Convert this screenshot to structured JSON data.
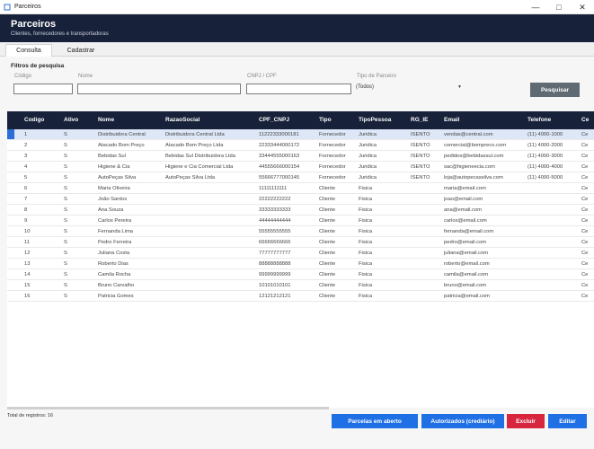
{
  "window": {
    "title": "Parceiros"
  },
  "header": {
    "title": "Parceiros",
    "subtitle": "Clientes, fornecedores e transportadoras"
  },
  "tabs": [
    {
      "label": "Consulta"
    },
    {
      "label": "Cadastrar"
    }
  ],
  "filters": {
    "title": "Filtros de pesquisa",
    "codigo_label": "Código",
    "nome_label": "Nome",
    "cnpj_label": "CNPJ / CPF",
    "tipo_label": "Tipo de Parceiro",
    "tipo_value": "(Todos)",
    "search_button": "Pesquisar"
  },
  "grid": {
    "columns": [
      "Codigo",
      "Ativo",
      "Nome",
      "RazaoSocial",
      "CPF_CNPJ",
      "Tipo",
      "TipoPessoa",
      "RG_IE",
      "Email",
      "Telefone",
      "Ce"
    ],
    "rows": [
      [
        "1",
        "S",
        "Distribuidora Central",
        "Distribuidora Central Ltda",
        "11222333000181",
        "Fornecedor",
        "Juridica",
        "ISENTO",
        "vendas@central.com",
        "(11) 4000-1000",
        "Ce"
      ],
      [
        "2",
        "S",
        "Atacado Bom Preço",
        "Atacado Bom Preço Ltda",
        "22333444000172",
        "Fornecedor",
        "Juridica",
        "ISENTO",
        "comercial@bompreco.com",
        "(11) 4000-2000",
        "Ce"
      ],
      [
        "3",
        "S",
        "Bebidas Sul",
        "Bebidas Sul Distribuidora Ltda",
        "33444555000163",
        "Fornecedor",
        "Juridica",
        "ISENTO",
        "pedidos@bebidassul.com",
        "(11) 4000-3000",
        "Ce"
      ],
      [
        "4",
        "S",
        "Higiene & Cia",
        "Higiene e Cia Comercial Ltda",
        "44555666000154",
        "Fornecedor",
        "Juridica",
        "ISENTO",
        "sac@higieneecia.com",
        "(11) 4000-4000",
        "Ce"
      ],
      [
        "5",
        "S",
        "AutoPeças Silva",
        "AutoPeças Silva Ltda",
        "55666777000145",
        "Fornecedor",
        "Juridica",
        "ISENTO",
        "loja@autopecassilva.com",
        "(11) 4000-5000",
        "Ce"
      ],
      [
        "6",
        "S",
        "Maria Oliveira",
        "",
        "11111111111",
        "Cliente",
        "Fisica",
        "",
        "maria@email.com",
        "",
        "Ce"
      ],
      [
        "7",
        "S",
        "João Santos",
        "",
        "22222222222",
        "Cliente",
        "Fisica",
        "",
        "joao@email.com",
        "",
        "Ce"
      ],
      [
        "8",
        "S",
        "Ana Souza",
        "",
        "33333333333",
        "Cliente",
        "Fisica",
        "",
        "ana@email.com",
        "",
        "Ce"
      ],
      [
        "9",
        "S",
        "Carlos Pereira",
        "",
        "44444444444",
        "Cliente",
        "Fisica",
        "",
        "carlos@email.com",
        "",
        "Ce"
      ],
      [
        "10",
        "S",
        "Fernanda Lima",
        "",
        "55555555555",
        "Cliente",
        "Fisica",
        "",
        "fernanda@email.com",
        "",
        "Ce"
      ],
      [
        "11",
        "S",
        "Pedro Ferreira",
        "",
        "66666666666",
        "Cliente",
        "Fisica",
        "",
        "pedro@email.com",
        "",
        "Ce"
      ],
      [
        "12",
        "S",
        "Juliana Costa",
        "",
        "77777777777",
        "Cliente",
        "Fisica",
        "",
        "juliana@email.com",
        "",
        "Ce"
      ],
      [
        "13",
        "S",
        "Roberto Dias",
        "",
        "88888888888",
        "Cliente",
        "Fisica",
        "",
        "roberto@email.com",
        "",
        "Ce"
      ],
      [
        "14",
        "S",
        "Camila Rocha",
        "",
        "99999999999",
        "Cliente",
        "Fisica",
        "",
        "camila@email.com",
        "",
        "Ce"
      ],
      [
        "15",
        "S",
        "Bruno Carvalho",
        "",
        "10101010101",
        "Cliente",
        "Fisica",
        "",
        "bruno@email.com",
        "",
        "Ce"
      ],
      [
        "16",
        "S",
        "Patricia Gomes",
        "",
        "12121212121",
        "Cliente",
        "Fisica",
        "",
        "patricia@email.com",
        "",
        "Ce"
      ]
    ]
  },
  "footer": {
    "total_label": "Total de registros: 16",
    "btn_parcelas": "Parcelas em aberto",
    "btn_autorizados": "Autorizados (crediário)",
    "btn_excluir": "Excluir",
    "btn_editar": "Editar"
  },
  "colors": {
    "header_bg": "#18213a",
    "primary": "#1f6fe5",
    "danger": "#d7263d",
    "search_btn": "#5f6a73",
    "selection": "#dde7f7"
  }
}
